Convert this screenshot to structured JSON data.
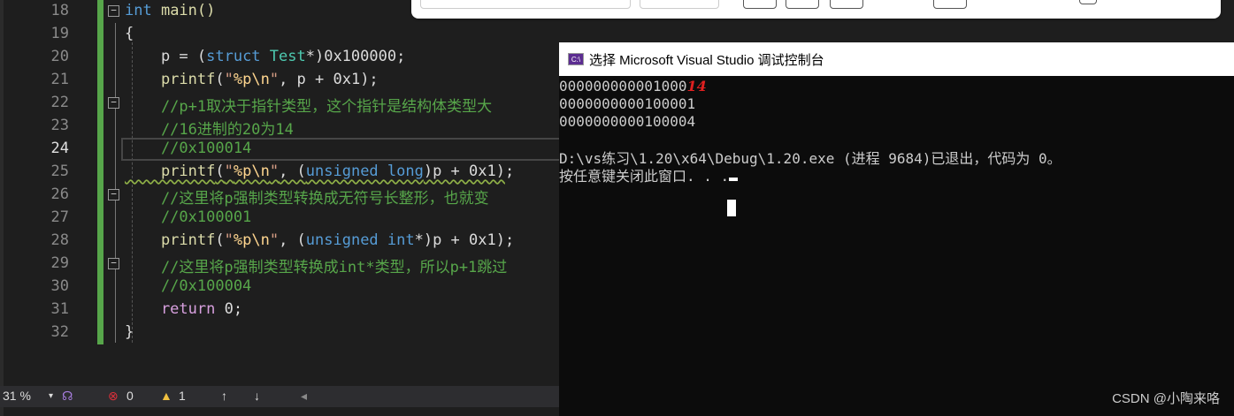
{
  "editor": {
    "line_numbers": [
      "18",
      "19",
      "20",
      "21",
      "22",
      "23",
      "24",
      "25",
      "26",
      "27",
      "28",
      "29",
      "30",
      "31",
      "32"
    ],
    "current_line": "24",
    "lines": [
      [
        {
          "t": "int",
          "c": "kw"
        },
        {
          "t": " main()",
          "c": "fn"
        }
      ],
      [
        {
          "t": "{",
          "c": ""
        }
      ],
      [
        {
          "t": "    p = (",
          "c": ""
        },
        {
          "t": "struct",
          "c": "kw"
        },
        {
          "t": " Test",
          "c": "ty"
        },
        {
          "t": "*)0x100000;",
          "c": ""
        }
      ],
      [
        {
          "t": "    printf",
          "c": "fn"
        },
        {
          "t": "(",
          "c": ""
        },
        {
          "t": "\"",
          "c": "st"
        },
        {
          "t": "%p",
          "c": "es"
        },
        {
          "t": "\\n",
          "c": "es"
        },
        {
          "t": "\"",
          "c": "st"
        },
        {
          "t": ", p + 0x1);",
          "c": ""
        }
      ],
      [
        {
          "t": "    //p+1取决于指针类型，这个指针是结构体类型大",
          "c": "cm"
        }
      ],
      [
        {
          "t": "    //16进制的20为14",
          "c": "cm"
        }
      ],
      [
        {
          "t": "    //0x100014",
          "c": "cm"
        }
      ],
      [
        {
          "t": "    printf",
          "c": "fn sq"
        },
        {
          "t": "(",
          "c": "sq"
        },
        {
          "t": "\"",
          "c": "st sq"
        },
        {
          "t": "%p\\n",
          "c": "es sq"
        },
        {
          "t": "\"",
          "c": "st sq"
        },
        {
          "t": ", (",
          "c": "sq"
        },
        {
          "t": "unsigned long",
          "c": "kw sq"
        },
        {
          "t": ")p + 0x1)",
          "c": "sq"
        },
        {
          "t": ";",
          "c": ""
        }
      ],
      [
        {
          "t": "    //这里将p强制类型转换成无符号长整形，也就变",
          "c": "cm"
        }
      ],
      [
        {
          "t": "    //0x100001",
          "c": "cm"
        }
      ],
      [
        {
          "t": "    printf",
          "c": "fn"
        },
        {
          "t": "(",
          "c": ""
        },
        {
          "t": "\"",
          "c": "st"
        },
        {
          "t": "%p\\n",
          "c": "es"
        },
        {
          "t": "\"",
          "c": "st"
        },
        {
          "t": ", (",
          "c": ""
        },
        {
          "t": "unsigned int",
          "c": "kw"
        },
        {
          "t": "*)p + 0x1);",
          "c": ""
        }
      ],
      [
        {
          "t": "    //这里将p强制类型转换成int*类型，所以p+1跳过",
          "c": "cm"
        }
      ],
      [
        {
          "t": "    //0x100004",
          "c": "cm"
        }
      ],
      [
        {
          "t": "    return",
          "c": "ct"
        },
        {
          "t": " 0;",
          "c": ""
        }
      ],
      [
        {
          "t": "}",
          "c": ""
        }
      ]
    ]
  },
  "status": {
    "zoom": "31 %",
    "errors": "0",
    "warnings": "1",
    "up": "↑",
    "down": "↓",
    "left": "◂"
  },
  "console": {
    "title": "选择 Microsoft Visual Studio 调试控制台",
    "icon_text": "C:\\",
    "out1_prefix": "000000000001000",
    "out1_annot": "14",
    "out2": "0000000000100001",
    "out3": "0000000000100004",
    "exit": "D:\\vs练习\\1.20\\x64\\Debug\\1.20.exe (进程 9684)已退出，代码为 0。",
    "prompt": "按任意键关闭此窗口. . ."
  },
  "watermark": "CSDN @小陶来咯"
}
